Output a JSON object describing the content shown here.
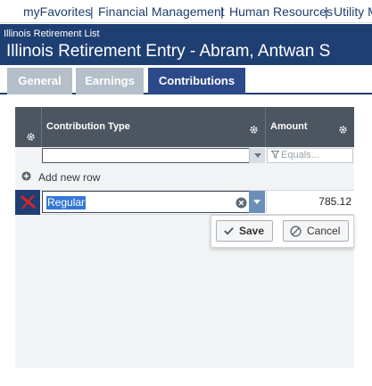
{
  "topnav": {
    "items": [
      "myFavorites",
      "Financial Management",
      "Human Resources",
      "Utility M"
    ]
  },
  "header": {
    "subtitle": "Illinois Retirement List",
    "title": "Illinois Retirement Entry - Abram, Antwan S"
  },
  "tabs": [
    {
      "label": "General",
      "active": false
    },
    {
      "label": "Earnings",
      "active": false
    },
    {
      "label": "Contributions",
      "active": true
    }
  ],
  "grid": {
    "columns": [
      {
        "label": "Contribution Type"
      },
      {
        "label": "Amount"
      }
    ],
    "filter": {
      "amount_placeholder": "Equals..."
    },
    "add_row_label": "Add new row",
    "rows": [
      {
        "type": "Regular",
        "amount": "785.12"
      }
    ],
    "edit_panel": {
      "save_label": "Save",
      "cancel_label": "Cancel"
    }
  },
  "colors": {
    "header_bg": "#1f3f73",
    "tab_active": "#2c4a8a",
    "tab_inactive": "#b4bfc9",
    "grid_header": "#4c5560",
    "selection": "#3478d6"
  }
}
